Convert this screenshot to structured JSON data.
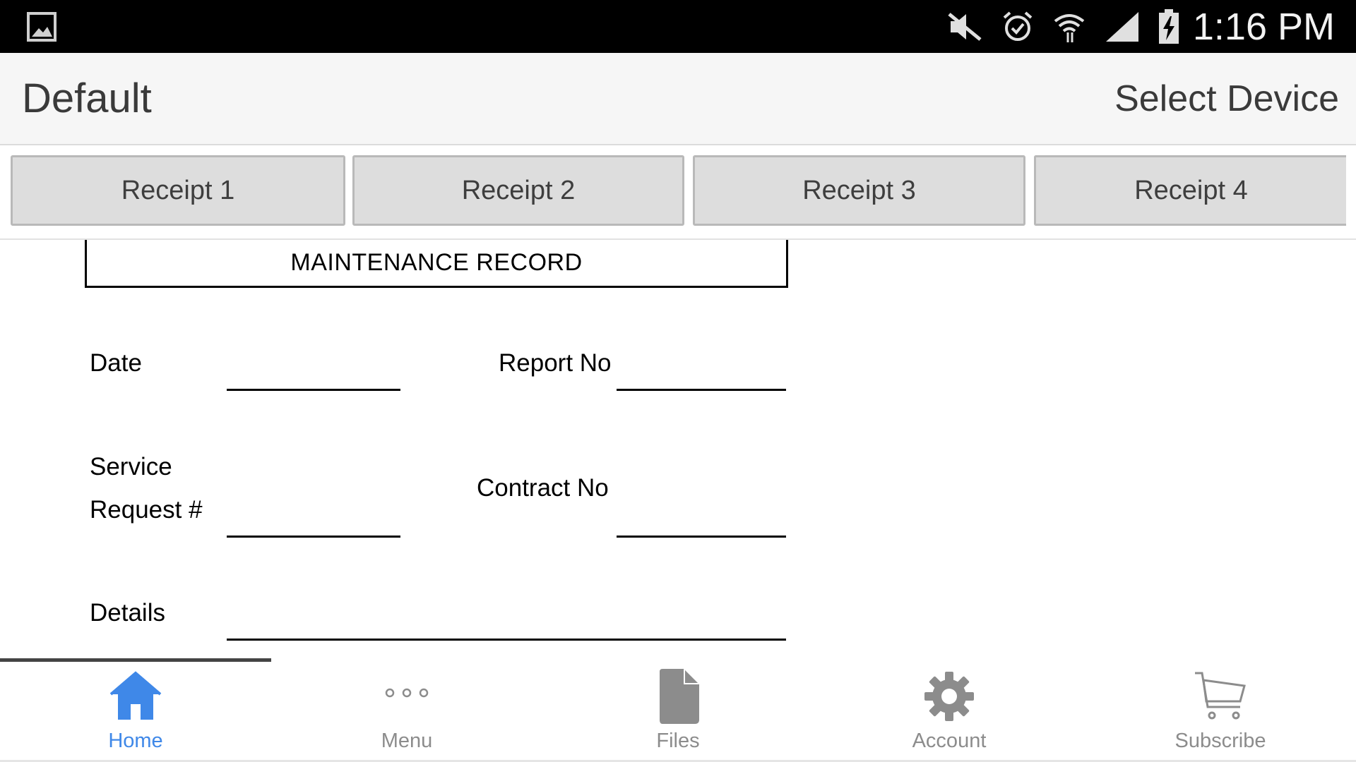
{
  "status_bar": {
    "time": "1:16 PM",
    "icons": [
      "gallery-icon",
      "mute-icon",
      "alarm-icon",
      "wifi-icon",
      "signal-icon",
      "battery-charging-icon"
    ]
  },
  "header": {
    "title": "Default",
    "action": "Select Device"
  },
  "tabs": [
    {
      "label": "Receipt 1"
    },
    {
      "label": "Receipt 2"
    },
    {
      "label": "Receipt 3"
    },
    {
      "label": "Receipt 4"
    }
  ],
  "form": {
    "title": "MAINTENANCE RECORD",
    "date_label": "Date",
    "report_no_label": "Report No",
    "service_label_line1": "Service",
    "service_label_line2": "Request #",
    "contract_no_label": "Contract No",
    "details_label": "Details"
  },
  "bottom_nav": {
    "items": [
      {
        "label": "Home",
        "icon": "home-icon",
        "active": true
      },
      {
        "label": "Menu",
        "icon": "more-dots-icon",
        "active": false
      },
      {
        "label": "Files",
        "icon": "file-icon",
        "active": false
      },
      {
        "label": "Account",
        "icon": "gear-icon",
        "active": false
      },
      {
        "label": "Subscribe",
        "icon": "cart-icon",
        "active": false
      }
    ]
  },
  "colors": {
    "accent": "#3f88e8",
    "inactive": "#8c8c8c",
    "tab_bg": "#dddddd"
  }
}
